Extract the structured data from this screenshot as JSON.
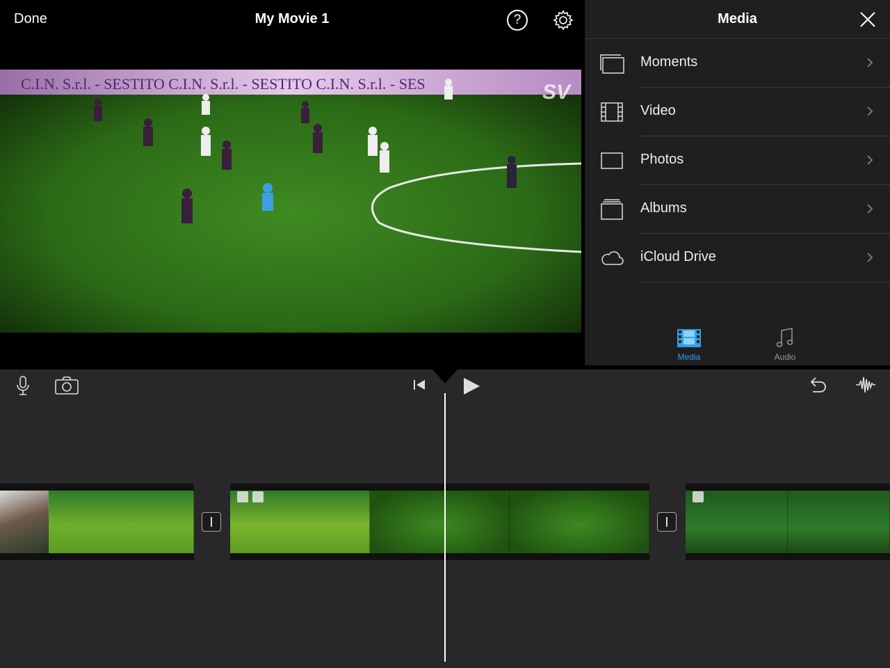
{
  "toolbar": {
    "done_label": "Done",
    "title": "My Movie 1",
    "help_label": "?"
  },
  "media_panel": {
    "title": "Media",
    "items": [
      {
        "label": "Moments",
        "icon": "moments-icon"
      },
      {
        "label": "Video",
        "icon": "film-icon"
      },
      {
        "label": "Photos",
        "icon": "photo-frame-icon"
      },
      {
        "label": "Albums",
        "icon": "albums-icon"
      },
      {
        "label": "iCloud Drive",
        "icon": "cloud-icon"
      }
    ],
    "tabs": [
      {
        "label": "Media",
        "icon": "film-strip-icon",
        "selected": true
      },
      {
        "label": "Audio",
        "icon": "music-note-icon",
        "selected": false
      }
    ],
    "accent_color": "#2fa1e8"
  },
  "viewer": {
    "banner_text": "C.I.N. S.r.l. - SESTITO   C.I.N. S.r.l. - SESTITO   C.I.N. S.r.l. - SES",
    "watermark": "SV"
  },
  "timeline": {
    "tools_left": [
      "microphone-icon",
      "camera-icon"
    ],
    "tools_center": [
      "skip-to-start-icon",
      "play-icon"
    ],
    "tools_right": [
      "undo-icon",
      "audio-waveform-icon"
    ]
  }
}
